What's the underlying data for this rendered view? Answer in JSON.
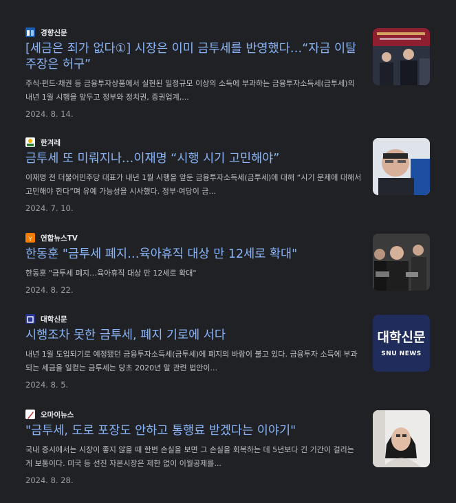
{
  "articles": [
    {
      "source": "경향신문",
      "title": "[세금은 죄가 없다①] 시장은 이미 금투세를 반영했다…“자금 이탈 주장은 허구”",
      "snippet": "주식·펀드·채권 등 금융투자상품에서 실현된 일정규모 이상의 소득에 부과하는 금융투자소득세(금투세)의 내년 1월 시행을 앞두고 정부와 정치권, 증권업계,...",
      "date": "2024. 8. 14.",
      "logo_color": "#1a5fb4"
    },
    {
      "source": "한겨레",
      "title": "금투세 또 미뤄지나…이재명 “시행 시기 고민해야”",
      "snippet": "이재명 전 더불어민주당 대표가 내년 1월 시행을 앞둔 금융투자소득세(금투세)에 대해 “시기 문제에 대해서 고민해야 한다”며 유예 가능성을 시사했다. 정부·여당이 금...",
      "date": "2024. 7. 10.",
      "logo_color": "#2e7d32"
    },
    {
      "source": "연합뉴스TV",
      "title": "한동훈 \"금투세 폐지…육아휴직 대상 만 12세로 확대\"",
      "snippet": "한동훈 \"금투세 폐지…육아휴직 대상 만 12세로 확대\"",
      "date": "2024. 8. 22.",
      "logo_color": "#f57c00"
    },
    {
      "source": "대학신문",
      "title": "시행조차 못한 금투세, 폐지 기로에 서다",
      "snippet": "내년 1월 도입되기로 예정됐던 금융투자소득세(금투세)에 폐지의 바람이 불고 있다. 금융투자 소득에 부과되는 세금을 일컫는 금투세는 당초 2020년 말 관련 법안이...",
      "date": "2024. 8. 5.",
      "logo_color": "#283593",
      "thumb_text_main": "대학신문",
      "thumb_text_sub": "SNU NEWS"
    },
    {
      "source": "오마이뉴스",
      "title": "\"금투세, 도로 포장도 안하고 통행료 받겠다는 이야기\"",
      "snippet": "국내 증시에서는 시장이 좋지 않을 때 한번 손실을 보면 그 손실을 회복하는 데 5년보다 긴 기간이 걸리는 게 보통이다. 미국 등 선진 자본시장은 제한 없이 이월공제를...",
      "date": "2024. 8. 28.",
      "logo_color": "#c62828"
    }
  ]
}
